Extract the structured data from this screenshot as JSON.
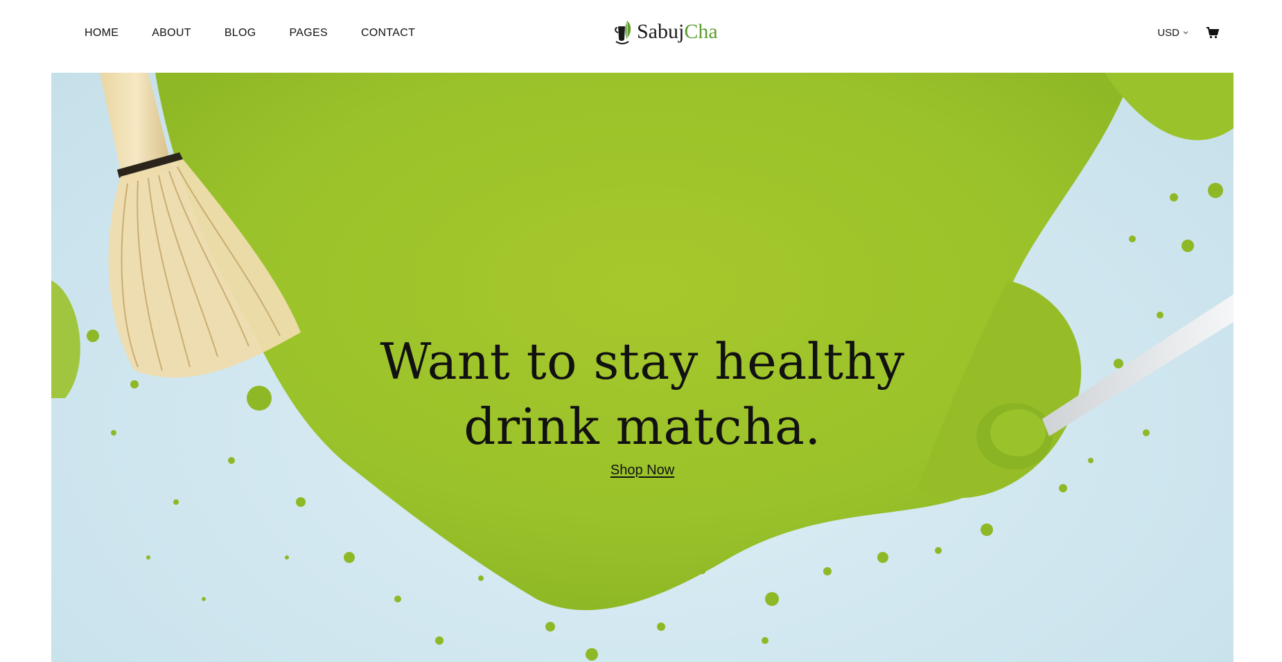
{
  "nav": {
    "items": [
      {
        "label": "HOME"
      },
      {
        "label": "ABOUT"
      },
      {
        "label": "BLOG"
      },
      {
        "label": "PAGES"
      },
      {
        "label": "CONTACT"
      }
    ]
  },
  "logo": {
    "word_dark": "Sabuj",
    "word_green": "Cha",
    "accent_color": "#5e9c2f"
  },
  "utils": {
    "currency": "USD",
    "cart_icon": "cart-icon"
  },
  "hero": {
    "headline_line1": "Want to stay healthy",
    "headline_line2": "drink matcha.",
    "cta_label": "Shop Now",
    "matcha_color": "#9ac22a",
    "background_color": "#d2e8f0"
  }
}
